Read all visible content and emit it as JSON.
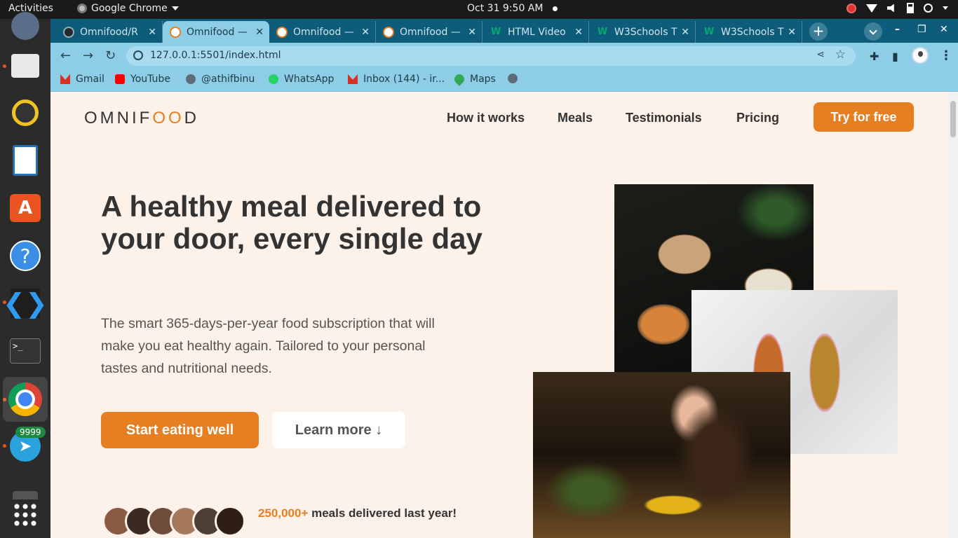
{
  "system": {
    "activities": "Activities",
    "app_name": "Google Chrome",
    "clock": "Oct 31  9:50 AM",
    "telegram_badge": "9999"
  },
  "browser": {
    "tabs": [
      {
        "title": "Omnifood/R",
        "favicon": "github-icon"
      },
      {
        "title": "Omnifood — ",
        "favicon": "omnifood-icon",
        "active": true
      },
      {
        "title": "Omnifood — ",
        "favicon": "omnifood-icon"
      },
      {
        "title": "Omnifood — ",
        "favicon": "omnifood-icon"
      },
      {
        "title": "HTML Video",
        "favicon": "w3schools-icon"
      },
      {
        "title": "W3Schools T",
        "favicon": "w3schools-icon"
      },
      {
        "title": "W3Schools T",
        "favicon": "w3schools-icon"
      }
    ],
    "url": "127.0.0.1:5501/index.html",
    "bookmarks": [
      {
        "label": "Gmail",
        "icon": "gmail-icon"
      },
      {
        "label": "YouTube",
        "icon": "youtube-icon"
      },
      {
        "label": "@athifbinu",
        "icon": "globe-icon"
      },
      {
        "label": "WhatsApp",
        "icon": "whatsapp-icon"
      },
      {
        "label": "Inbox (144) - ir...",
        "icon": "gmail-icon"
      },
      {
        "label": "Maps",
        "icon": "maps-icon"
      }
    ],
    "accent": "#8ecde6",
    "tabstrip_color": "#0d5c7a"
  },
  "page": {
    "logo": {
      "pre": "OMNIF",
      "oo": "OO",
      "post": "D"
    },
    "nav": [
      "How it works",
      "Meals",
      "Testimonials",
      "Pricing"
    ],
    "cta": "Try for free",
    "hero": {
      "title": "A healthy meal delivered to your door, every single day",
      "text": "The smart 365-days-per-year food subscription that will make you eat healthy again. Tailored to your personal tastes and nutritional needs.",
      "primary_button": "Start eating well",
      "secondary_button": "Learn more ↓",
      "delivered_number": "250,000+",
      "delivered_text": " meals delivered last year!"
    },
    "brand_color": "#e67e22",
    "background": "#fdf2e9"
  }
}
